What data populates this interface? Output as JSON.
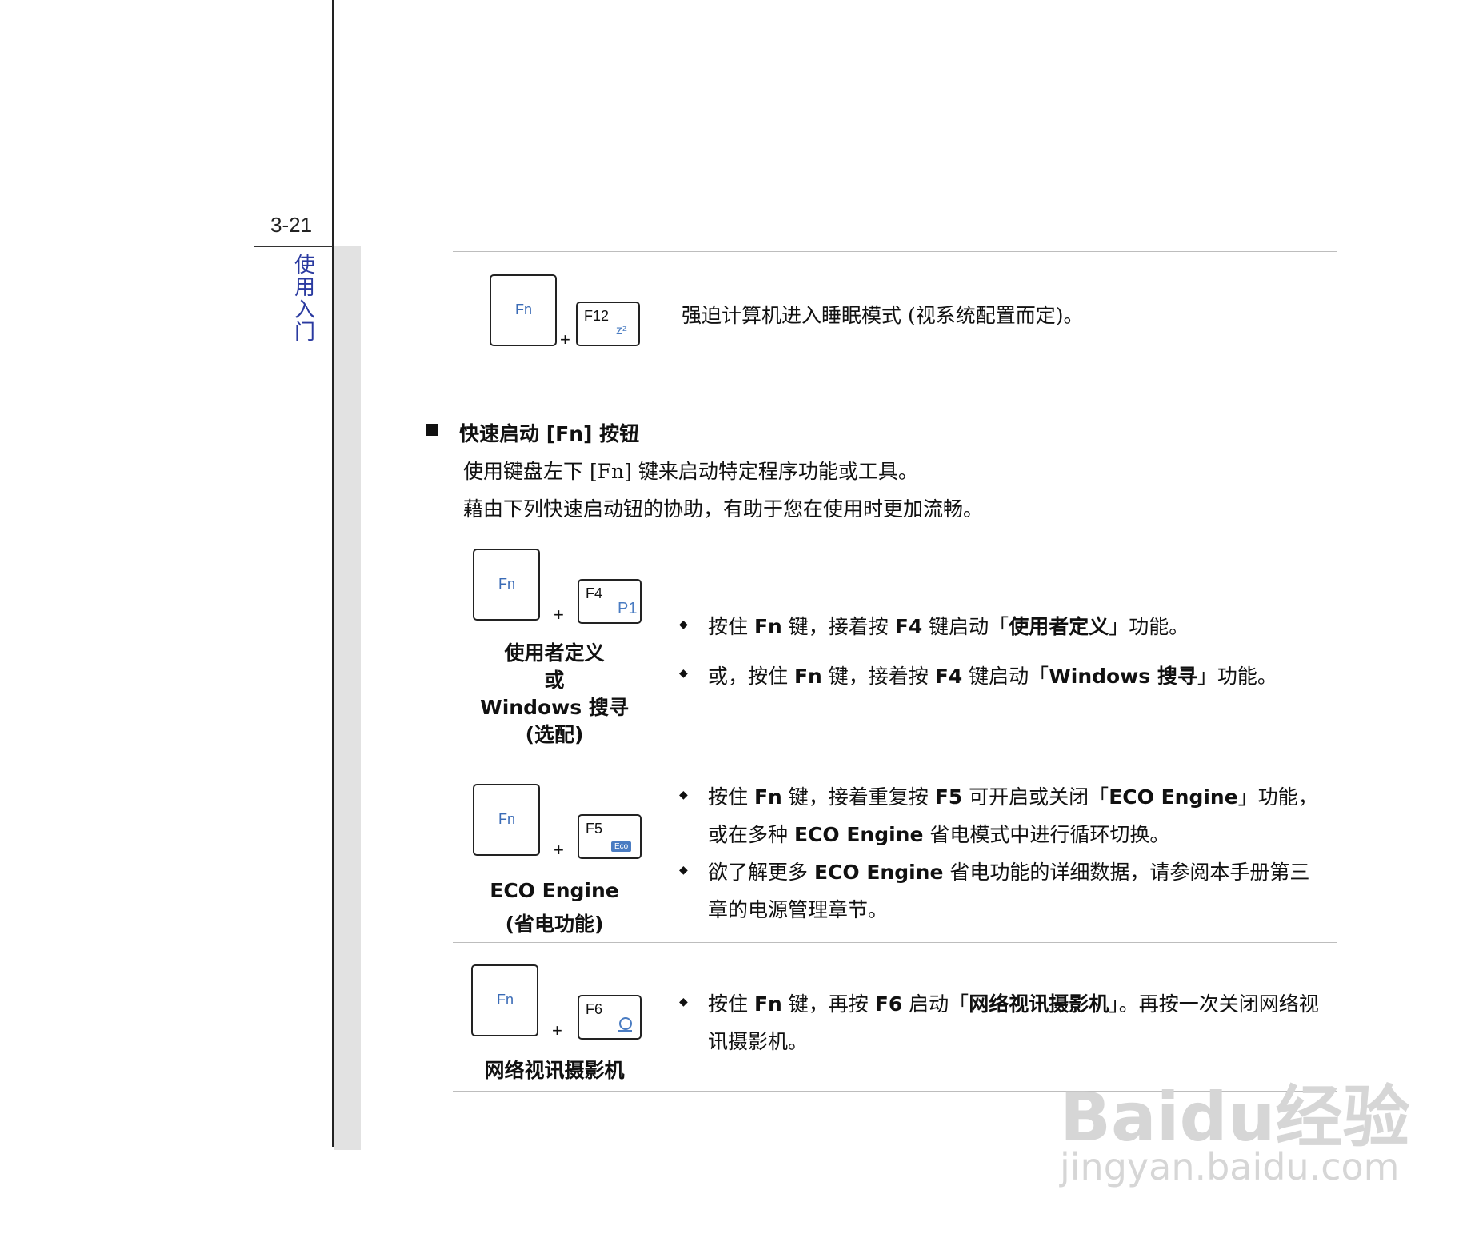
{
  "page": {
    "number": "3-21",
    "chapter": "使用入门"
  },
  "row_f12": {
    "fn": "Fn",
    "key": "F12",
    "symbol": "zᶻ",
    "plus": "+",
    "desc": "强迫计算机进入睡眠模式 (视系统配置而定)。"
  },
  "section": {
    "title": "快速启动 [Fn] 按钮",
    "intro1": "使用键盘左下 [Fn] 键来启动特定程序功能或工具。",
    "intro2": "藉由下列快速启动钮的协助，有助于您在使用时更加流畅。"
  },
  "row_f4": {
    "fn": "Fn",
    "key": "F4",
    "symbol": "P1",
    "plus": "+",
    "caption": [
      "使用者定义",
      "或",
      "Windows 搜寻",
      "(选配)"
    ],
    "b1": {
      "pre": "按住 ",
      "k1": "Fn",
      "mid": " 键，接着按 ",
      "k2": "F4",
      "post": " 键启动「",
      "name": "使用者定义",
      "end": "」功能。"
    },
    "b2": {
      "pre": "或，按住 ",
      "k1": "Fn",
      "mid": " 键，接着按 ",
      "k2": "F4",
      "post": " 键启动「",
      "name": "Windows 搜寻",
      "end": "」功能。"
    }
  },
  "row_f5": {
    "fn": "Fn",
    "key": "F5",
    "symbol": "Eco",
    "plus": "+",
    "caption": [
      "ECO Engine",
      "(省电功能)"
    ],
    "b1": {
      "pre": "按住 ",
      "k1": "Fn",
      "mid": " 键，接着重复按 ",
      "k2": "F5",
      "post": " 可开启或关闭「",
      "name": "ECO Engine",
      "end": "」功能，",
      "line2_pre": "或在多种 ",
      "line2_b": "ECO Engine",
      "line2_post": " 省电模式中进行循环切换。"
    },
    "b2": {
      "pre": "欲了解更多 ",
      "b": "ECO Engine",
      "post": " 省电功能的详细数据，请参阅本手册第三",
      "line2": "章的电源管理章节。"
    }
  },
  "row_f6": {
    "fn": "Fn",
    "key": "F6",
    "plus": "+",
    "caption": [
      "网络视讯摄影机"
    ],
    "b1": {
      "pre": "按住 ",
      "k1": "Fn",
      "mid": " 键，再按 ",
      "k2": "F6",
      "post": " 启动「",
      "name": "网络视讯摄影机",
      "end": "」。再按一次关闭网络视",
      "line2": "讯摄影机。"
    }
  },
  "bullets": {
    "diamond": "◆",
    "square": "■"
  },
  "watermark": {
    "logo": "Bai",
    "paw": "du",
    "cn": "经验",
    "url": "jingyan.baidu.com"
  }
}
